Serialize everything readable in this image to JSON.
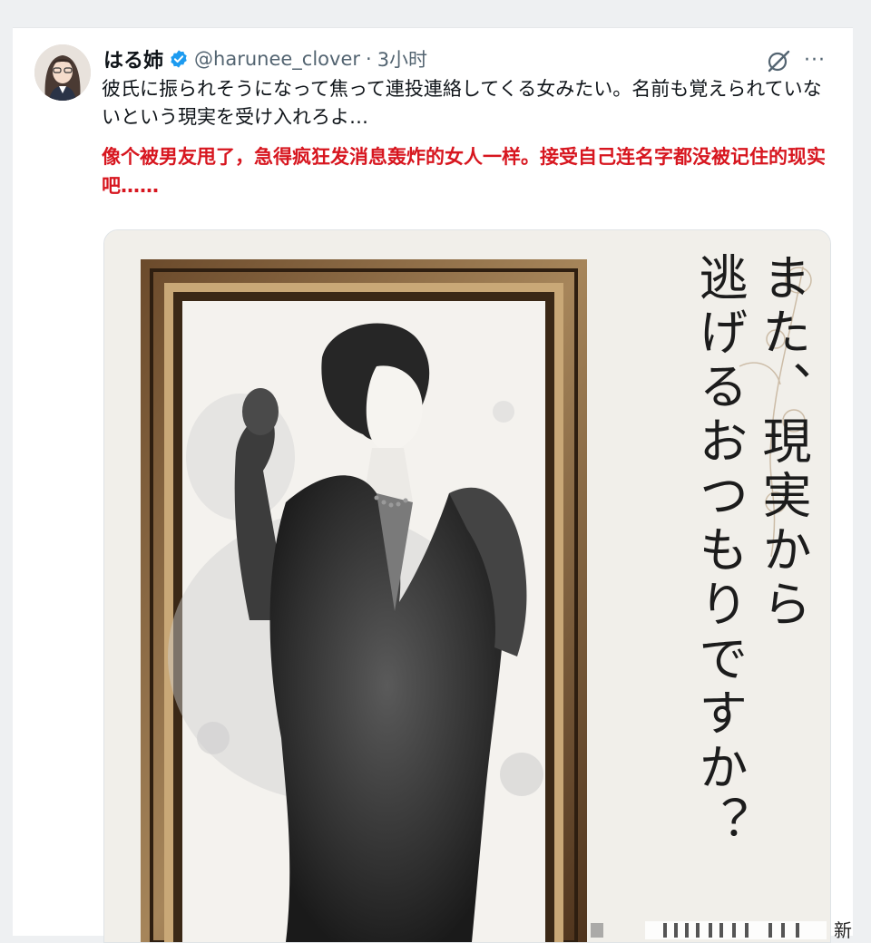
{
  "post": {
    "display_name": "はる姉",
    "handle": "@harunee_clover",
    "separator": "·",
    "time": "3小时",
    "text": "彼氏に振られそうになって焦って連投連絡してくる女みたい。名前も覚えられていないという現実を受け入れろよ…",
    "translation": "像个被男友甩了，急得疯狂发消息轰炸的女人一样。接受自己连名字都没被记住的现实吧……",
    "more_label": "···"
  },
  "media": {
    "caption_lines": [
      "また、現実から",
      "逃げるおつもりですか？"
    ],
    "alt": "ink-wash portrait of a woman in a suit raising her fist, in a wooden frame"
  },
  "watermark": {
    "text": "新"
  },
  "colors": {
    "text_primary": "#0f1419",
    "text_secondary": "#536471",
    "translation_red": "#d7161f",
    "verified_blue": "#1d9bf0"
  },
  "icons": {
    "verified": "verified-badge-icon",
    "grok": "grok-icon",
    "more": "more-icon"
  }
}
